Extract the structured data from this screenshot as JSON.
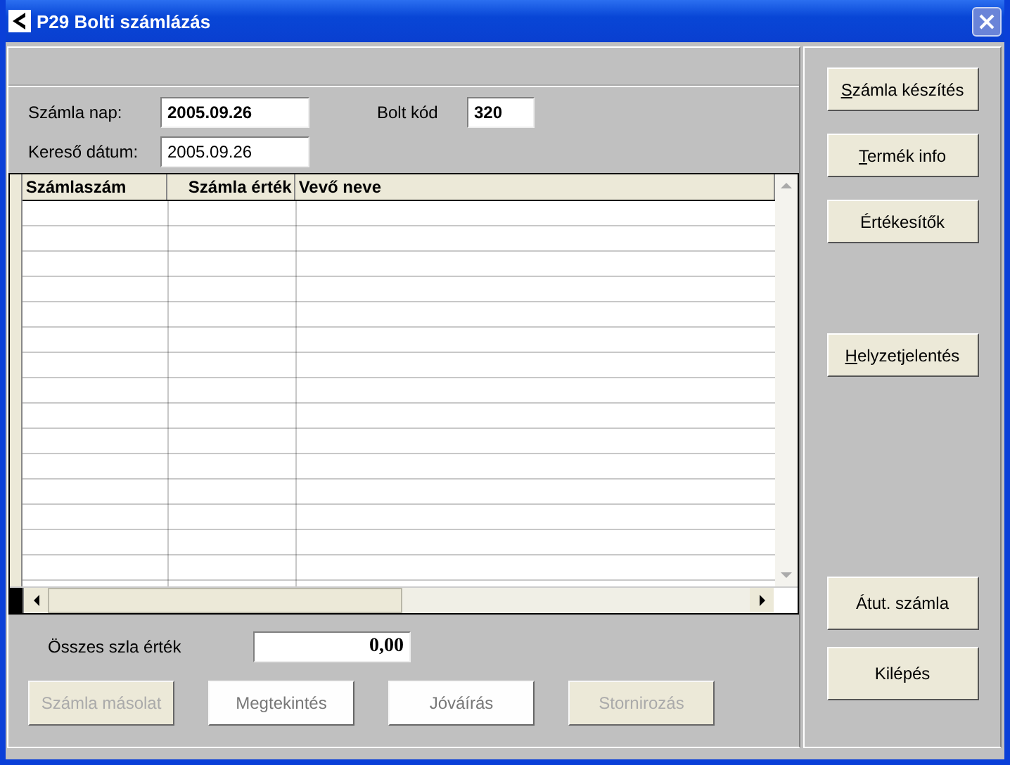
{
  "window": {
    "title": "P29 Bolti számlázás"
  },
  "fields": [
    {
      "label": "Számla nap:",
      "value": "2005.09.26",
      "bold": true
    },
    {
      "label": "Bolt kód",
      "value": "320",
      "bold": true
    },
    {
      "label": "Kereső dátum:",
      "value": "2005.09.26",
      "bold": false
    }
  ],
  "table": {
    "columns": [
      "Számlaszám",
      "Számla érték",
      "Vevő neve"
    ]
  },
  "total": {
    "label": "Összes szla érték",
    "value": "0,00"
  },
  "bottom_buttons": [
    {
      "label": "Számla másolat",
      "disabled": true
    },
    {
      "label": "Megtekintés",
      "disabled": false
    },
    {
      "label": "Jóváírás",
      "disabled": false
    },
    {
      "label": "Stornirozás",
      "disabled": true
    }
  ],
  "side_buttons": [
    {
      "label": "Számla készítés",
      "accelerator": true
    },
    {
      "label": "Termék info",
      "accelerator": true
    },
    {
      "label": "Értékesítők",
      "accelerator": false
    },
    {
      "label": "Helyzetjelentés",
      "accelerator": true
    },
    {
      "label": "Átut. számla",
      "accelerator": false
    },
    {
      "label": "Kilépés",
      "accelerator": false
    }
  ]
}
